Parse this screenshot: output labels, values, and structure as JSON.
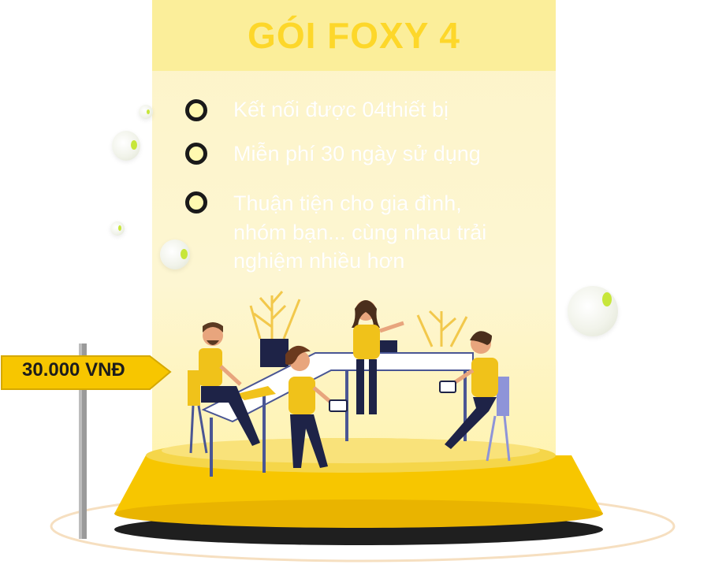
{
  "package": {
    "title": "GÓI FOXY 4",
    "features": [
      "Kết nối được 04thiết bị",
      "Miễn phí 30 ngày sử dụng",
      "Thuận tiện cho gia đình,",
      "nhóm bạn... cùng nhau trải",
      "nghiệm nhiều hơn"
    ],
    "price": "30.000 VNĐ"
  },
  "colors": {
    "accent": "#fdd72a",
    "panel": "#fdf4c8",
    "stage": "#f7c600",
    "ink": "#1a1a1a"
  },
  "icons": [
    "bullet-ring-icon",
    "signpost-icon",
    "bubble-icon",
    "team-illustration"
  ]
}
